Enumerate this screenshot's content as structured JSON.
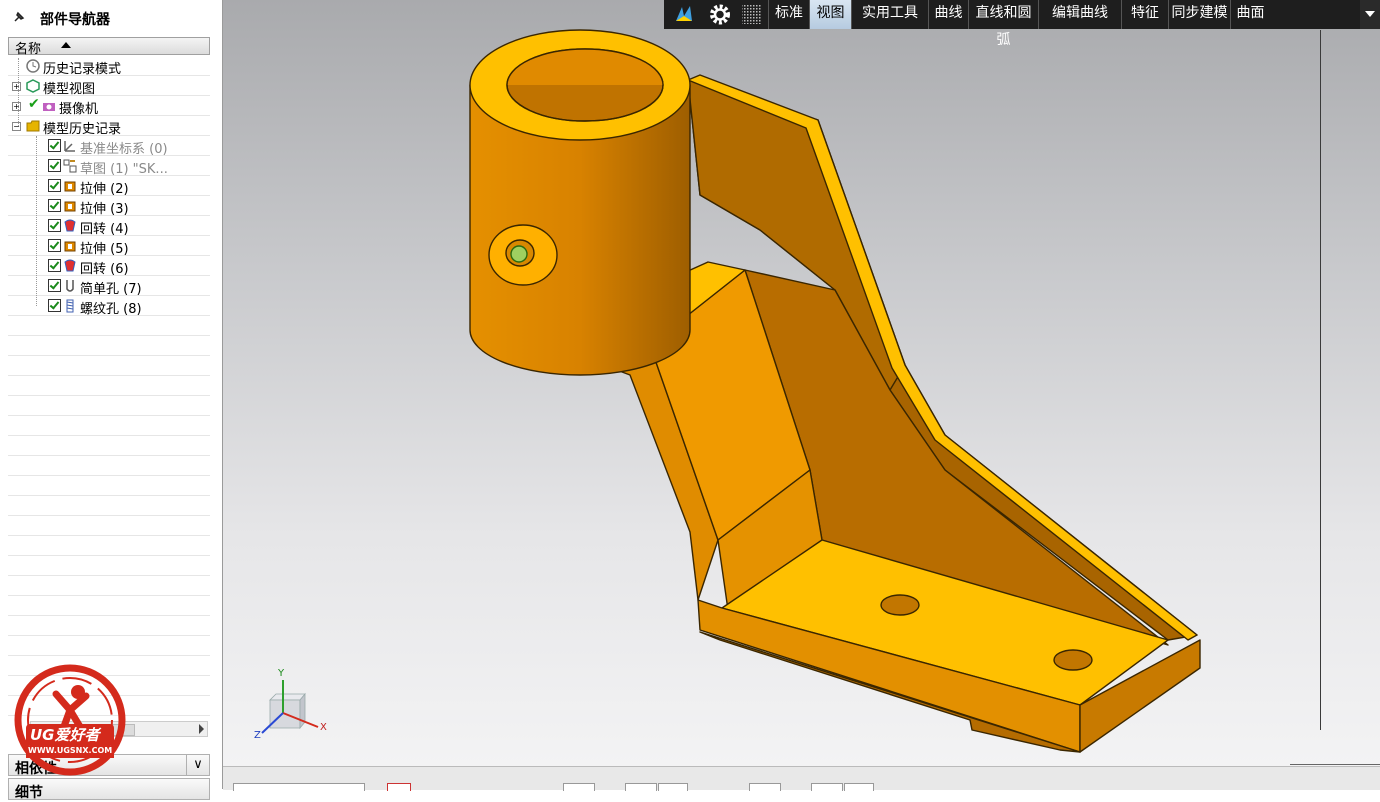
{
  "navigator": {
    "title": "部件导航器",
    "column_header": "名称",
    "rows": [
      {
        "label": "历史记录模式",
        "icon": "clock-icon",
        "grey": false
      },
      {
        "label": "模型视图",
        "icon": "model-views-icon",
        "grey": false
      },
      {
        "label": "摄像机",
        "icon": "camera-icon",
        "grey": false
      },
      {
        "label": "模型历史记录",
        "icon": "folder-icon",
        "grey": false
      },
      {
        "label": "基准坐标系 (0)",
        "icon": "datum-csys-icon",
        "grey": true
      },
      {
        "label": "草图 (1) \"SK...",
        "icon": "sketch-icon",
        "grey": true
      },
      {
        "label": "拉伸 (2)",
        "icon": "extrude-icon",
        "grey": false
      },
      {
        "label": "拉伸 (3)",
        "icon": "extrude-icon",
        "grey": false
      },
      {
        "label": "回转 (4)",
        "icon": "revolve-icon",
        "grey": false
      },
      {
        "label": "拉伸 (5)",
        "icon": "extrude-icon",
        "grey": false
      },
      {
        "label": "回转 (6)",
        "icon": "revolve-icon",
        "grey": false
      },
      {
        "label": "简单孔 (7)",
        "icon": "simple-hole-icon",
        "grey": false
      },
      {
        "label": "螺纹孔 (8)",
        "icon": "threaded-hole-icon",
        "grey": false
      }
    ],
    "panel_dependencies": "相依性",
    "panel_details": "细节"
  },
  "toolbar": {
    "tabs": [
      "标准",
      "视图",
      "实用工具",
      "曲线",
      "直线和圆弧",
      "编辑曲线",
      "特征",
      "同步建模",
      "曲面"
    ],
    "active_tab": "视图",
    "icons": [
      "role-icon",
      "settings-gear-icon",
      "grid-icon"
    ]
  },
  "triad": {
    "x": "X",
    "y": "Y",
    "z": "Z"
  },
  "logo": {
    "text": "UG爱好者",
    "url_text": "WWW.UGSNX.COM"
  },
  "colors": {
    "part_face": "#ffc000",
    "part_side": "#e39000",
    "part_dark": "#b86d00",
    "edge": "#3a2600",
    "active_tab": "#c5d7ea"
  }
}
